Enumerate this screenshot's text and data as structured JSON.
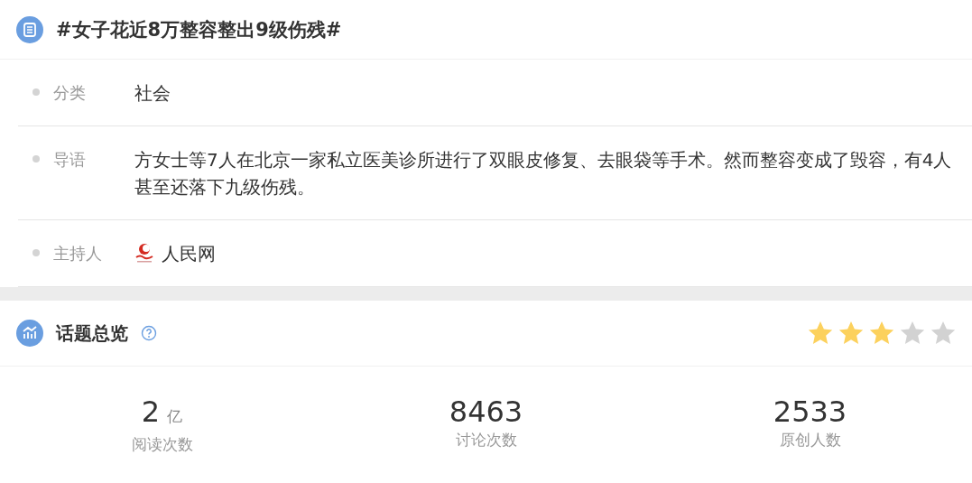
{
  "title": "#女子花近8万整容整出9级伤残#",
  "details": [
    {
      "label": "分类",
      "value": "社会"
    },
    {
      "label": "导语",
      "value": "方女士等7人在北京一家私立医美诊所进行了双眼皮修复、去眼袋等手术。然而整容变成了毁容，有4人甚至还落下九级伤残。"
    },
    {
      "label": "主持人",
      "value": "人民网",
      "kind": "host"
    }
  ],
  "overview": {
    "title": "话题总览",
    "stars": 3,
    "stats": [
      {
        "value": "2",
        "unit": "亿",
        "label": "阅读次数"
      },
      {
        "value": "8463",
        "label": "讨论次数"
      },
      {
        "value": "2533",
        "label": "原创人数"
      }
    ]
  }
}
